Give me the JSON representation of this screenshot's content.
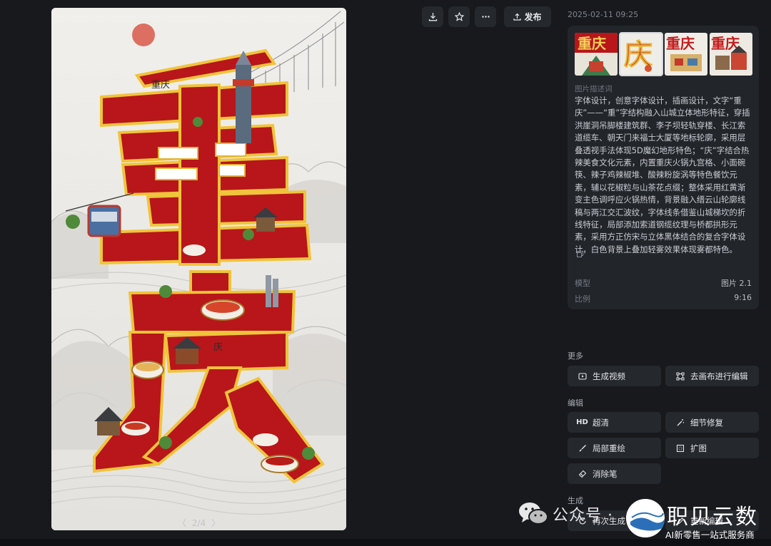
{
  "toolbar": {
    "download_icon": "download-icon",
    "favorite_icon": "star-icon",
    "more_icon": "more-icon",
    "publish_label": "发布"
  },
  "image_viewer": {
    "big_chars": "重庆",
    "top_left_stamp": "重庆",
    "pager": {
      "prev": "〈",
      "text": "2/4",
      "next": "〉"
    }
  },
  "details": {
    "timestamp": "2025-02-11 09:25",
    "thumbnails": [
      "重庆",
      "庆",
      "重庆",
      "重庆"
    ],
    "selected_thumbnail": 1,
    "description_label": "图片描述词",
    "description": "字体设计，创意字体设计，插画设计，文字“重庆”——“重”字结构融入山城立体地形特征，穿插洪崖洞吊脚楼建筑群、李子坝轻轨穿楼、长江索道缆车、朝天门来福士大厦等地标轮廓，采用层叠透视手法体现5D魔幻地形特色；“庆”字结合热辣美食文化元素，内置重庆火锅九宫格、小面碗筷、辣子鸡辣椒堆、酸辣粉旋涡等特色餐饮元素，辅以花椒粒与山茶花点缀；整体采用红黄渐变主色调呼应火锅热情，背景融入缙云山轮廓线稿与两江交汇波纹，字体线条借鉴山城梯坎的折线特征，局部添加索道钢缆纹理与桥都拱形元素，采用方正仿宋与立体黑体结合的复合字体设计，白色背景上叠加轻雾效果体现雾都特色。",
    "model_label": "模型",
    "model_value": "图片 2.1",
    "ratio_label": "比例",
    "ratio_value": "9:16"
  },
  "more": {
    "label": "更多",
    "generate_video": "生成视频",
    "edit_in_canvas": "去画布进行编辑"
  },
  "edit": {
    "label": "编辑",
    "hd_icon_text": "HD",
    "upscale": "超清",
    "detail_repair": "细节修复",
    "inpaint": "局部重绘",
    "expand": "扩图",
    "eraser": "消除笔"
  },
  "generate": {
    "label": "生成",
    "regenerate": "再次生成",
    "reedit": "重新编辑"
  },
  "watermark": {
    "gzh": "公众号 ·",
    "name": "职贝云数",
    "subtitle": "AI新零售一站式服务商"
  },
  "colors": {
    "background": "#17191d",
    "panel": "#22252a",
    "button": "#25282d",
    "poster_red": "#b8161a",
    "poster_gold": "#e8b838"
  }
}
